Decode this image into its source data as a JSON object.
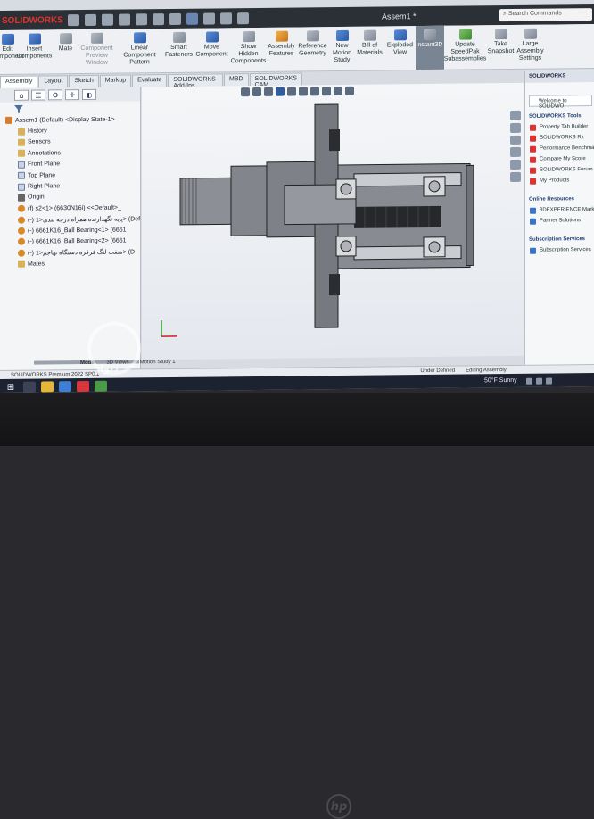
{
  "app": {
    "logo": "SOLIDWORKS",
    "document_title": "Assem1 *",
    "search_placeholder": "Search Commands"
  },
  "ribbon": [
    {
      "label": "Edit\nComponent",
      "icon": "edit-component-icon",
      "color": "blue",
      "state": "normal"
    },
    {
      "label": "Insert\nComponents",
      "icon": "insert-components-icon",
      "color": "blue",
      "state": "normal"
    },
    {
      "label": "Mate",
      "icon": "mate-icon",
      "color": "grey",
      "state": "normal"
    },
    {
      "label": "Component\nPreview\nWindow",
      "icon": "component-preview-icon",
      "color": "grey",
      "state": "disabled"
    },
    {
      "label": "Linear Component\nPattern",
      "icon": "linear-pattern-icon",
      "color": "blue",
      "state": "normal"
    },
    {
      "label": "Smart\nFasteners",
      "icon": "smart-fasteners-icon",
      "color": "grey",
      "state": "normal"
    },
    {
      "label": "Move\nComponent",
      "icon": "move-component-icon",
      "color": "blue",
      "state": "normal"
    },
    {
      "label": "Show\nHidden\nComponents",
      "icon": "show-hidden-icon",
      "color": "grey",
      "state": "normal"
    },
    {
      "label": "Assembly\nFeatures",
      "icon": "assembly-features-icon",
      "color": "orange",
      "state": "normal"
    },
    {
      "label": "Reference\nGeometry",
      "icon": "reference-geometry-icon",
      "color": "grey",
      "state": "normal"
    },
    {
      "label": "New\nMotion\nStudy",
      "icon": "motion-study-icon",
      "color": "blue",
      "state": "normal"
    },
    {
      "label": "Bill of\nMaterials",
      "icon": "bom-icon",
      "color": "grey",
      "state": "normal"
    },
    {
      "label": "Exploded\nView",
      "icon": "exploded-view-icon",
      "color": "blue",
      "state": "normal"
    },
    {
      "label": "Instant3D",
      "icon": "instant3d-icon",
      "color": "grey",
      "state": "active"
    },
    {
      "label": "Update\nSpeedPak\nSubassemblies",
      "icon": "speedpak-icon",
      "color": "green",
      "state": "normal"
    },
    {
      "label": "Take\nSnapshot",
      "icon": "snapshot-icon",
      "color": "grey",
      "state": "normal"
    },
    {
      "label": "Large\nAssembly\nSettings",
      "icon": "large-assembly-icon",
      "color": "grey",
      "state": "normal"
    }
  ],
  "command_tabs": [
    {
      "label": "Assembly",
      "active": true
    },
    {
      "label": "Layout",
      "active": false
    },
    {
      "label": "Sketch",
      "active": false
    },
    {
      "label": "Markup",
      "active": false
    },
    {
      "label": "Evaluate",
      "active": false
    },
    {
      "label": "SOLIDWORKS Add-Ins",
      "active": false
    },
    {
      "label": "MBD",
      "active": false
    },
    {
      "label": "SOLIDWORKS CAM",
      "active": false
    }
  ],
  "feature_tree": [
    {
      "label": "Assem1 (Default) <Display State-1>",
      "indent": 0,
      "icon": "asm"
    },
    {
      "label": "History",
      "indent": 1,
      "icon": "folder"
    },
    {
      "label": "Sensors",
      "indent": 1,
      "icon": "folder"
    },
    {
      "label": "Annotations",
      "indent": 1,
      "icon": "folder"
    },
    {
      "label": "Front Plane",
      "indent": 1,
      "icon": "plane"
    },
    {
      "label": "Top Plane",
      "indent": 1,
      "icon": "plane"
    },
    {
      "label": "Right Plane",
      "indent": 1,
      "icon": "plane"
    },
    {
      "label": "Origin",
      "indent": 1,
      "icon": "origin"
    },
    {
      "label": "(f) s2<1> (6630N16i) <<Default>_",
      "indent": 1,
      "icon": "part"
    },
    {
      "label": "(-) پایه نگهدارنده همراه درجه بندی<1> (Def",
      "indent": 1,
      "icon": "part"
    },
    {
      "label": "(-) 6661K16_Ball Bearing<1> (6661",
      "indent": 1,
      "icon": "part"
    },
    {
      "label": "(-) 6661K16_Ball Bearing<2> (6661",
      "indent": 1,
      "icon": "part"
    },
    {
      "label": "(-) شفت لنگ فرقره دستگاه تهاجم<1> (D",
      "indent": 1,
      "icon": "part"
    },
    {
      "label": "Mates",
      "indent": 1,
      "icon": "folder"
    }
  ],
  "task_pane": {
    "header": "SOLIDWORKS",
    "welcome": "Welcome to SOLIDWO",
    "tools_title": "SOLIDWORKS Tools",
    "tools": [
      "Property Tab Builder",
      "SOLIDWORKS Rx",
      "Performance Benchma",
      "Compare My Score",
      "SOLIDWORKS Forum",
      "My Products"
    ],
    "online_title": "Online Resources",
    "online": [
      "3DEXPERIENCE Marketp",
      "Partner Solutions"
    ],
    "subscription_title": "Subscription Services",
    "subscription": [
      "Subscription Services"
    ]
  },
  "bottom_tabs": [
    {
      "label": "Model",
      "active": true
    },
    {
      "label": "3D Views",
      "active": false
    },
    {
      "label": "Motion Study 1",
      "active": false
    }
  ],
  "status_bar": {
    "left": "SOLIDWORKS Premium 2022 SP0.1",
    "middle": "Under Defined",
    "right": "Editing Assembly"
  },
  "taskbar": {
    "weather": "50°F  Sunny"
  },
  "watermark": {
    "text": "دیوار"
  },
  "bezel": {
    "brand": "hp"
  },
  "colors": {
    "title_bar": "#2b2f36",
    "ribbon": "#eef0f3",
    "accent": "#2f5c9c",
    "logo_red": "#e0352b",
    "model_grey": "#7b7e84"
  }
}
